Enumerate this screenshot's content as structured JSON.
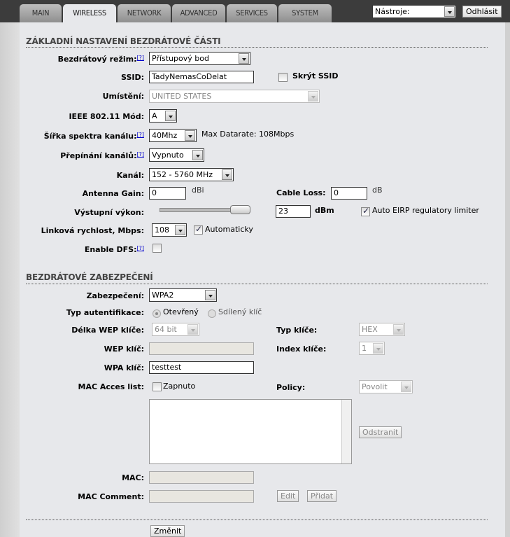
{
  "tabs": [
    "MAIN",
    "WIRELESS",
    "NETWORK",
    "ADVANCED",
    "SERVICES",
    "SYSTEM"
  ],
  "tools_select": "Nástroje:",
  "logout": "Odhlásit",
  "help": "[?]",
  "basic": {
    "title": "ZÁKLADNÍ NASTAVENÍ BEZDRÁTOVÉ ČÁSTI",
    "mode_label": "Bezdrátový režim:",
    "mode": "Přístupový bod",
    "ssid_label": "SSID:",
    "ssid": "TadyNemasCoDelat",
    "hide_ssid": "Skrýt SSID",
    "country_label": "Umístění:",
    "country": "UNITED STATES",
    "ieee_label": "IEEE 802.11 Mód:",
    "ieee": "A",
    "width_label": "Šířka spektra kanálu:",
    "width": "40Mhz",
    "max_datarate": "Max Datarate: 108Mbps",
    "switch_label": "Přepínání kanálů:",
    "switch": "Vypnuto",
    "channel_label": "Kanál:",
    "channel": "152 - 5760 MHz",
    "gain_label": "Antenna Gain:",
    "gain": "0",
    "gain_unit": "dBi",
    "loss_label": "Cable Loss:",
    "loss": "0",
    "loss_unit": "dB",
    "power_label": "Výstupní výkon:",
    "power": "23",
    "power_unit": "dBm",
    "power_fraction": 1.0,
    "eirp": "Auto EIRP regulatory limiter",
    "rate_label": "Linková rychlost, Mbps:",
    "rate": "108",
    "auto": "Automaticky",
    "dfs_label": "Enable DFS:"
  },
  "security": {
    "title": "BEZDRÁTOVÉ ZABEZPEČENÍ",
    "sec_label": "Zabezpečení:",
    "sec": "WPA2",
    "auth_label": "Typ autentifikace:",
    "auth_open": "Otevřený",
    "auth_shared": "Sdílený klíč",
    "wep_len_label": "Délka WEP klíče:",
    "wep_len": "64 bit",
    "key_type_label": "Typ klíče:",
    "key_type": "HEX",
    "wep_key_label": "WEP klíč:",
    "key_index_label": "Index klíče:",
    "key_index": "1",
    "wpa_key_label": "WPA klíč:",
    "wpa_key": "testtest",
    "mac_acl_label": "MAC Acces list:",
    "enabled": "Zapnuto",
    "policy_label": "Policy:",
    "policy": "Povolit",
    "remove": "Odstranit",
    "mac_label": "MAC:",
    "mac_comment_label": "MAC Comment:",
    "edit": "Edit",
    "add": "Přidat"
  },
  "change": "Změnit"
}
